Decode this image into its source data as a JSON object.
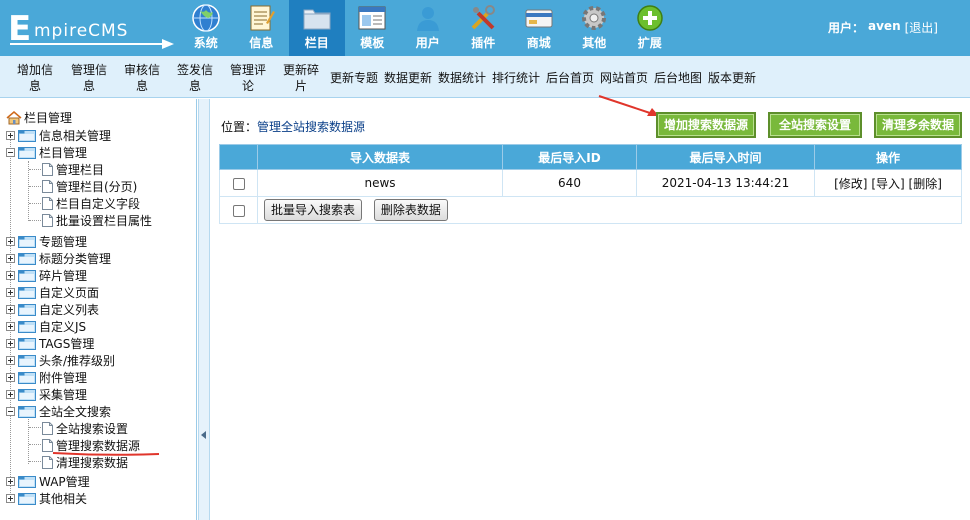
{
  "app": {
    "logo_text": "EmpireCMS",
    "nav": [
      {
        "label": "系统",
        "icon": "globe-icon"
      },
      {
        "label": "信息",
        "icon": "notepad-icon"
      },
      {
        "label": "栏目",
        "icon": "folder-icon",
        "active": true
      },
      {
        "label": "模板",
        "icon": "template-window-icon"
      },
      {
        "label": "用户",
        "icon": "user-icon"
      },
      {
        "label": "插件",
        "icon": "tools-icon"
      },
      {
        "label": "商城",
        "icon": "card-icon"
      },
      {
        "label": "其他",
        "icon": "gear-icon"
      },
      {
        "label": "扩展",
        "icon": "plus-circle-icon"
      }
    ],
    "user_label": "用户：",
    "username": "aven",
    "logout": "[退出]",
    "colors": {
      "header": "#4aa8d8",
      "active_nav": "#1f7fc0",
      "green_button": "#79b93b"
    }
  },
  "subbar": {
    "items": [
      {
        "l1": "增加信",
        "l2": "息"
      },
      {
        "l1": "管理信",
        "l2": "息"
      },
      {
        "l1": "审核信",
        "l2": "息"
      },
      {
        "l1": "签发信",
        "l2": "息"
      },
      {
        "l1": "管理评",
        "l2": "论"
      },
      {
        "l1": "更新碎",
        "l2": "片"
      }
    ],
    "single": [
      "更新专题",
      "数据更新",
      "数据统计",
      "排行统计",
      "后台首页",
      "网站首页",
      "后台地图",
      "版本更新"
    ]
  },
  "sidebar": {
    "root": "栏目管理",
    "items": [
      "信息相关管理",
      "栏目管理",
      "管理栏目",
      "管理栏目(分页)",
      "栏目自定义字段",
      "批量设置栏目属性",
      "专题管理",
      "标题分类管理",
      "碎片管理",
      "自定义页面",
      "自定义列表",
      "自定义JS",
      "TAGS管理",
      "头条/推荐级别",
      "附件管理",
      "采集管理",
      "全站全文搜索",
      "全站搜索设置",
      "管理搜索数据源",
      "清理搜索数据",
      "WAP管理",
      "其他相关"
    ]
  },
  "main": {
    "position_label": "位置：",
    "position_link": "管理全站搜索数据源",
    "buttons": {
      "add_source": "增加搜索数据源",
      "search_settings": "全站搜索设置",
      "clean_data": "清理多余数据"
    },
    "table": {
      "headers": [
        "导入数据表",
        "最后导入ID",
        "最后导入时间",
        "操作"
      ],
      "rows": [
        {
          "table": "news",
          "last_id": "640",
          "last_time": "2021-04-13 13:44:21",
          "ops": [
            "[修改]",
            "[导入]",
            "[删除]"
          ]
        }
      ],
      "footer_buttons": [
        "批量导入搜索表",
        "删除表数据"
      ]
    }
  }
}
